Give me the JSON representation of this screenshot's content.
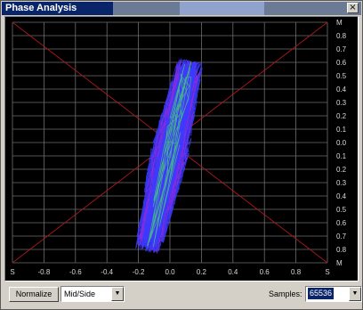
{
  "window": {
    "title": "Phase Analysis"
  },
  "plot": {
    "right_ticks": [
      "M",
      "0.8",
      "0.7",
      "0.6",
      "0.5",
      "0.4",
      "0.3",
      "0.2",
      "0.1",
      "0.0",
      "0.1",
      "0.2",
      "0.3",
      "0.4",
      "0.5",
      "0.6",
      "0.7",
      "0.8",
      "M"
    ],
    "bottom_ticks": [
      "S",
      "-0.8",
      "-0.6",
      "-0.4",
      "-0.2",
      "0.0",
      "0.2",
      "0.4",
      "0.6",
      "0.8",
      "S"
    ],
    "colors": {
      "grid": "#6e6e6e",
      "diagonal": "#b01818",
      "trace_main": "#3a3aff",
      "trace_alt": "#8a2be2",
      "trace_green": "#40c080"
    }
  },
  "controls": {
    "normalize_label": "Normalize",
    "mode_value": "Mid/Side",
    "samples_label": "Samples:",
    "samples_value": "65536",
    "dropdown_icon": "triangle-down-icon"
  }
}
